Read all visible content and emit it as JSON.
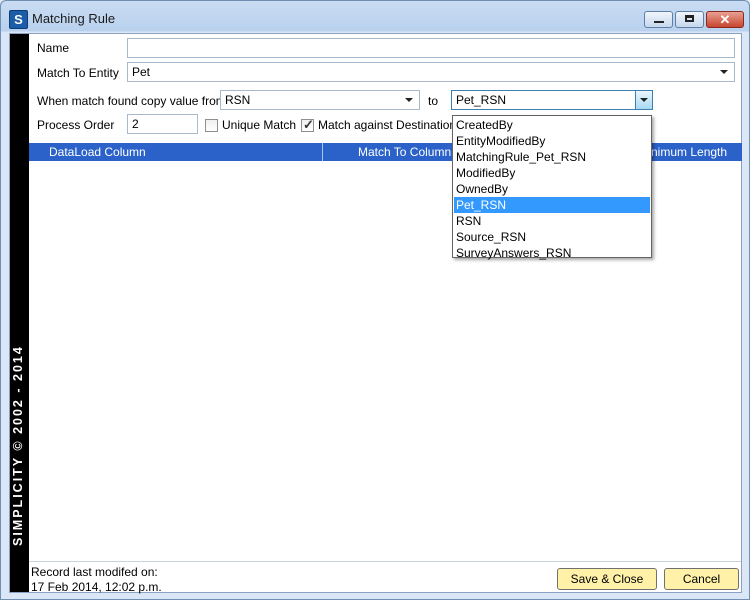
{
  "window": {
    "title": "Matching Rule",
    "app_icon_letter": "S"
  },
  "sidebar": {
    "text": "SIMPLICITY © 2002 - 2014"
  },
  "form": {
    "name_label": "Name",
    "name_value": "",
    "entity_label": "Match To Entity",
    "entity_value": "Pet",
    "copy_label": "When match found copy value from",
    "copy_from_value": "RSN",
    "to_label": "to",
    "copy_to_value": "Pet_RSN",
    "order_label": "Process Order",
    "order_value": "2",
    "unique_label": "Unique Match",
    "unique_checked": false,
    "dest_label": "Match against Destination I",
    "dest_checked": true
  },
  "grid": {
    "columns": [
      "DataLoad Column",
      "Match To Column",
      "nimum Length"
    ]
  },
  "dropdown": {
    "options": [
      "CreatedBy",
      "EntityModifiedBy",
      "MatchingRule_Pet_RSN",
      "ModifiedBy",
      "OwnedBy",
      "Pet_RSN",
      "RSN",
      "Source_RSN",
      "SurveyAnswers_RSN"
    ],
    "selected": "Pet_RSN"
  },
  "footer": {
    "status_label": "Record last modifed on:",
    "status_date": "17 Feb 2014, 12:02 p.m.",
    "save_label": "Save & Close",
    "cancel_label": "Cancel"
  }
}
